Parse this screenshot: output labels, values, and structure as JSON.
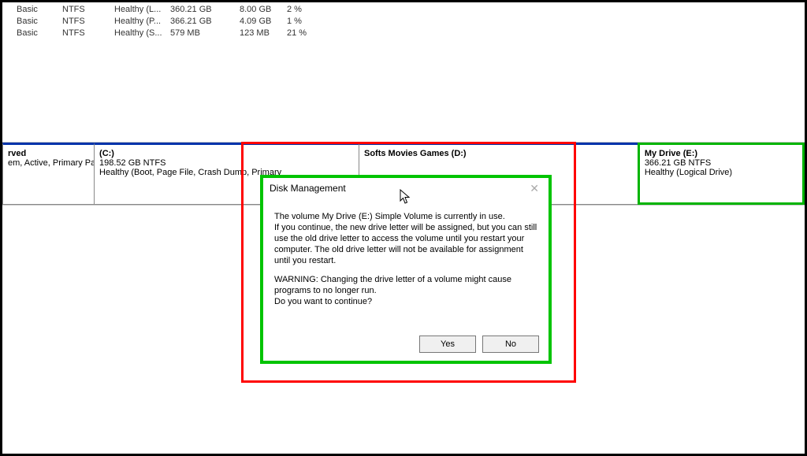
{
  "volume_list": [
    {
      "layout": "Basic",
      "fs": "NTFS",
      "status": "Healthy (L...",
      "capacity": "360.21 GB",
      "free": "8.00 GB",
      "pct": "2 %"
    },
    {
      "layout": "Basic",
      "fs": "NTFS",
      "status": "Healthy (P...",
      "capacity": "366.21 GB",
      "free": "4.09 GB",
      "pct": "1 %"
    },
    {
      "layout": "Basic",
      "fs": "NTFS",
      "status": "Healthy (S...",
      "capacity": "579 MB",
      "free": "123 MB",
      "pct": "21 %"
    }
  ],
  "partitions": {
    "p1": {
      "name": "rved",
      "size": "",
      "status": "em, Active, Primary Pa"
    },
    "p2": {
      "name": "(C:)",
      "size": "198.52 GB NTFS",
      "status": "Healthy (Boot, Page File, Crash Dump, Primary"
    },
    "p3": {
      "name": "Softs  Movies  Games  (D:)",
      "size": "",
      "status": ""
    },
    "p4": {
      "name": "My Drive  (E:)",
      "size": "366.21 GB NTFS",
      "status": "Healthy (Logical Drive)"
    }
  },
  "dialog": {
    "title": "Disk Management",
    "line1": "The volume My Drive (E:) Simple Volume is currently in use.",
    "line2": "If you continue, the new drive letter will be assigned, but you can still use the old drive letter to access the volume until you restart your computer. The old drive letter will not be available for assignment until you restart.",
    "warn": "WARNING: Changing the drive letter of a volume might cause programs to no longer run.",
    "confirm": "Do you want to continue?",
    "yes": "Yes",
    "no": "No"
  }
}
